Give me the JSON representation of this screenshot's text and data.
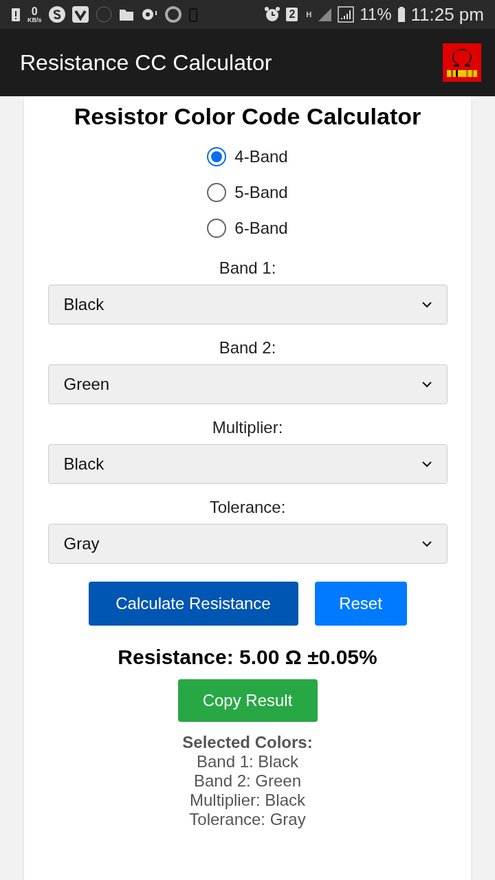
{
  "status_bar": {
    "speed_value": "0",
    "speed_unit": "KB/s",
    "sim_slot": "2",
    "network_type": "H",
    "battery": "11%",
    "time": "11:25 pm"
  },
  "app_bar": {
    "title": "Resistance CC Calculator"
  },
  "card": {
    "title": "Resistor Color Code Calculator",
    "band_modes": [
      {
        "label": "4-Band",
        "selected": true
      },
      {
        "label": "5-Band",
        "selected": false
      },
      {
        "label": "6-Band",
        "selected": false
      }
    ],
    "selects": [
      {
        "label": "Band 1:",
        "value": "Black"
      },
      {
        "label": "Band 2:",
        "value": "Green"
      },
      {
        "label": "Multiplier:",
        "value": "Black"
      },
      {
        "label": "Tolerance:",
        "value": "Gray"
      }
    ],
    "buttons": [
      {
        "label": "Calculate Resistance",
        "kind": "primary"
      },
      {
        "label": "Reset",
        "kind": "secondary"
      }
    ],
    "result": "Resistance: 5.00 Ω ±0.05%",
    "copy_button": "Copy Result",
    "selected_colors": {
      "heading": "Selected Colors:",
      "lines": [
        "Band 1: Black",
        "Band 2: Green",
        "Multiplier: Black",
        "Tolerance: Gray"
      ]
    }
  }
}
